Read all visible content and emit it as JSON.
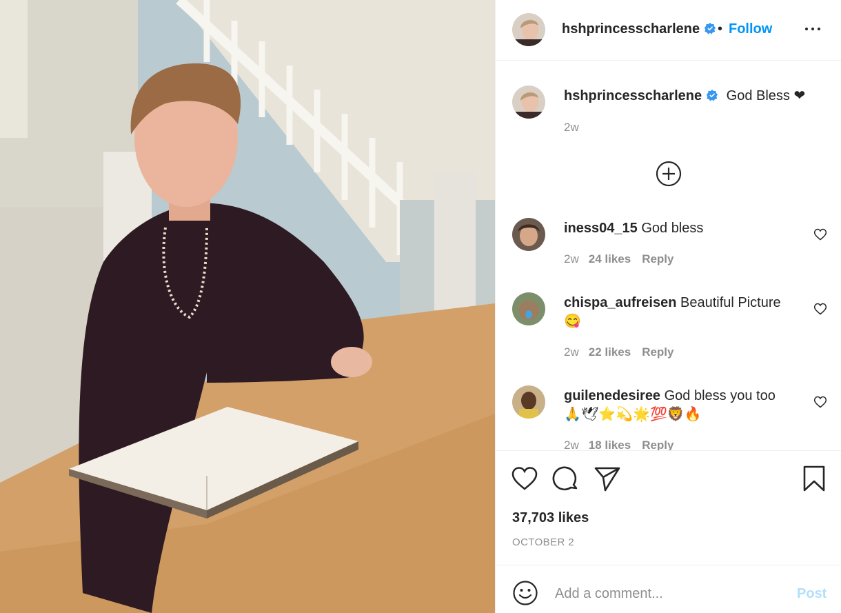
{
  "post": {
    "image_alt": "Woman seated at a wooden table with an open book",
    "author": "hshprincesscharlene",
    "follow_label": "Follow",
    "separator": "•",
    "more_icon": "more-options-icon",
    "caption": {
      "username": "hshprincesscharlene",
      "text": "God Bless ❤",
      "time": "2w"
    },
    "load_more_icon": "plus-circle-icon",
    "comments": [
      {
        "username": "iness04_15",
        "text": "God bless",
        "time": "2w",
        "likes": "24 likes",
        "reply": "Reply"
      },
      {
        "username": "chispa_aufreisen",
        "text": "Beautiful Picture 😋",
        "time": "2w",
        "likes": "22 likes",
        "reply": "Reply"
      },
      {
        "username": "guilenedesiree",
        "text": "God bless you too 🙏🕊⭐💫🌟💯🦁🔥",
        "time": "2w",
        "likes": "18 likes",
        "reply": "Reply"
      }
    ],
    "likes_total": "37,703 likes",
    "date": "OCTOBER 2",
    "comment_placeholder": "Add a comment...",
    "post_label": "Post"
  },
  "colors": {
    "link": "#0095f6",
    "post_disabled": "#b2dffc",
    "muted": "#8e8e8e",
    "verified": "#3897f0"
  }
}
